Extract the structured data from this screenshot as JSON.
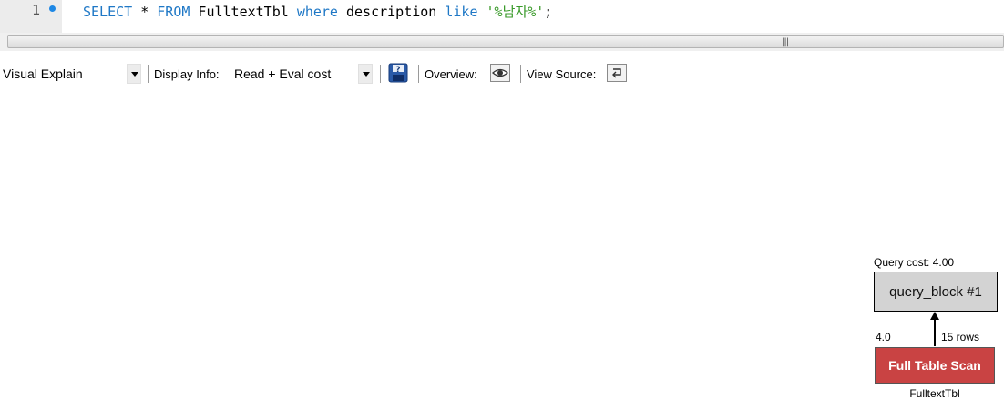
{
  "editor": {
    "line_number": "1",
    "code_tokens": [
      {
        "text": "SELECT",
        "type": "keyword"
      },
      {
        "text": " * ",
        "type": "plain"
      },
      {
        "text": "FROM",
        "type": "keyword"
      },
      {
        "text": " FulltextTbl ",
        "type": "plain"
      },
      {
        "text": "where",
        "type": "keyword"
      },
      {
        "text": " description ",
        "type": "plain"
      },
      {
        "text": "like",
        "type": "keyword"
      },
      {
        "text": " ",
        "type": "plain"
      },
      {
        "text": "'%남자%'",
        "type": "string"
      },
      {
        "text": ";",
        "type": "plain"
      }
    ],
    "colors": {
      "keyword": "#1f78c6",
      "string": "#3a9a2a"
    }
  },
  "toolbar": {
    "view_select": "Visual Explain",
    "display_info_label": "Display Info:",
    "display_info_value": "Read + Eval cost",
    "save_icon": "save-icon",
    "overview_label": "Overview:",
    "overview_icon": "eye-icon",
    "view_source_label": "View Source:",
    "view_source_icon": "source-icon"
  },
  "diagram": {
    "query_cost": "Query cost: 4.00",
    "query_block": "query_block #1",
    "edge_cost": "4.0",
    "edge_rows": "15 rows",
    "access_type": "Full Table Scan",
    "table_name": "FulltextTbl",
    "colors": {
      "access_fill": "#c94343",
      "block_fill": "#d3d3d3"
    }
  }
}
